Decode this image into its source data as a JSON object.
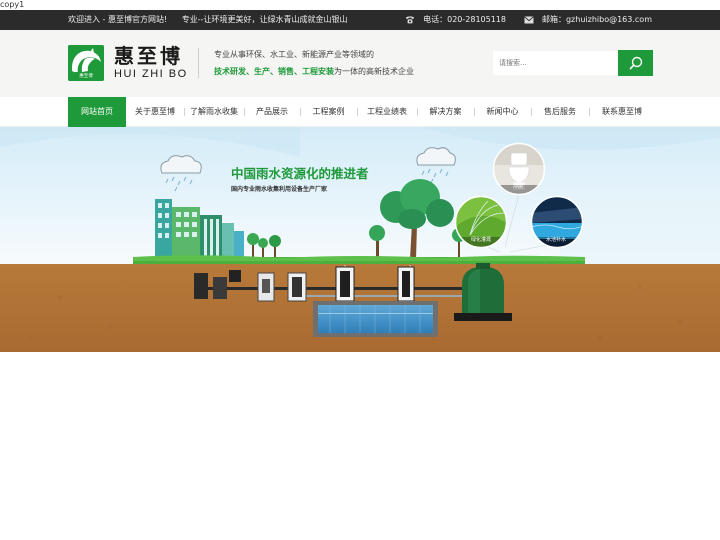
{
  "page": {
    "label": "copy1"
  },
  "topbar": {
    "welcome": "欢迎进入 - 惠至博官方网站!",
    "tagline": "专业--让环境更美好，让绿水青山成就金山银山",
    "phone": "电话：020-28105118",
    "email": "邮箱：gzhuizhibo@163.com"
  },
  "header": {
    "logo_cn": "惠至博",
    "logo_en": "HUI ZHI BO",
    "logo_badge": "惠至博",
    "slogan_line1": "专业从事环保、水工业、新能源产业等领域的",
    "slogan_line2_highlight": "技术研发、生产、销售、工程安装",
    "slogan_line2_rest": "为一体的高新技术企业",
    "search_placeholder": "请搜索..."
  },
  "nav": {
    "items": [
      {
        "label": "网站首页",
        "active": true
      },
      {
        "label": "关于惠至博"
      },
      {
        "label": "了解雨水收集"
      },
      {
        "label": "产品展示"
      },
      {
        "label": "工程案例"
      },
      {
        "label": "工程业绩表"
      },
      {
        "label": "解决方案"
      },
      {
        "label": "新闻中心"
      },
      {
        "label": "售后服务"
      },
      {
        "label": "联系惠至博"
      }
    ]
  },
  "banner": {
    "title": "中国雨水资源化的推进者",
    "subtitle": "国内专业雨水收集利用设备生产厂家",
    "circle_labels": {
      "toilet": "冲厕",
      "greening": "绿化灌溉",
      "pool": "水池补水"
    }
  },
  "colors": {
    "brand_green": "#1e9a3a",
    "topbar_bg": "#2b2b2b",
    "header_bg": "#f5f5f3",
    "soil": "#b5793a",
    "sky": "#dff1fb"
  },
  "icons": {
    "phone": "phone-icon",
    "email": "mail-icon",
    "search": "search-icon",
    "logo": "horse-logo-icon"
  }
}
